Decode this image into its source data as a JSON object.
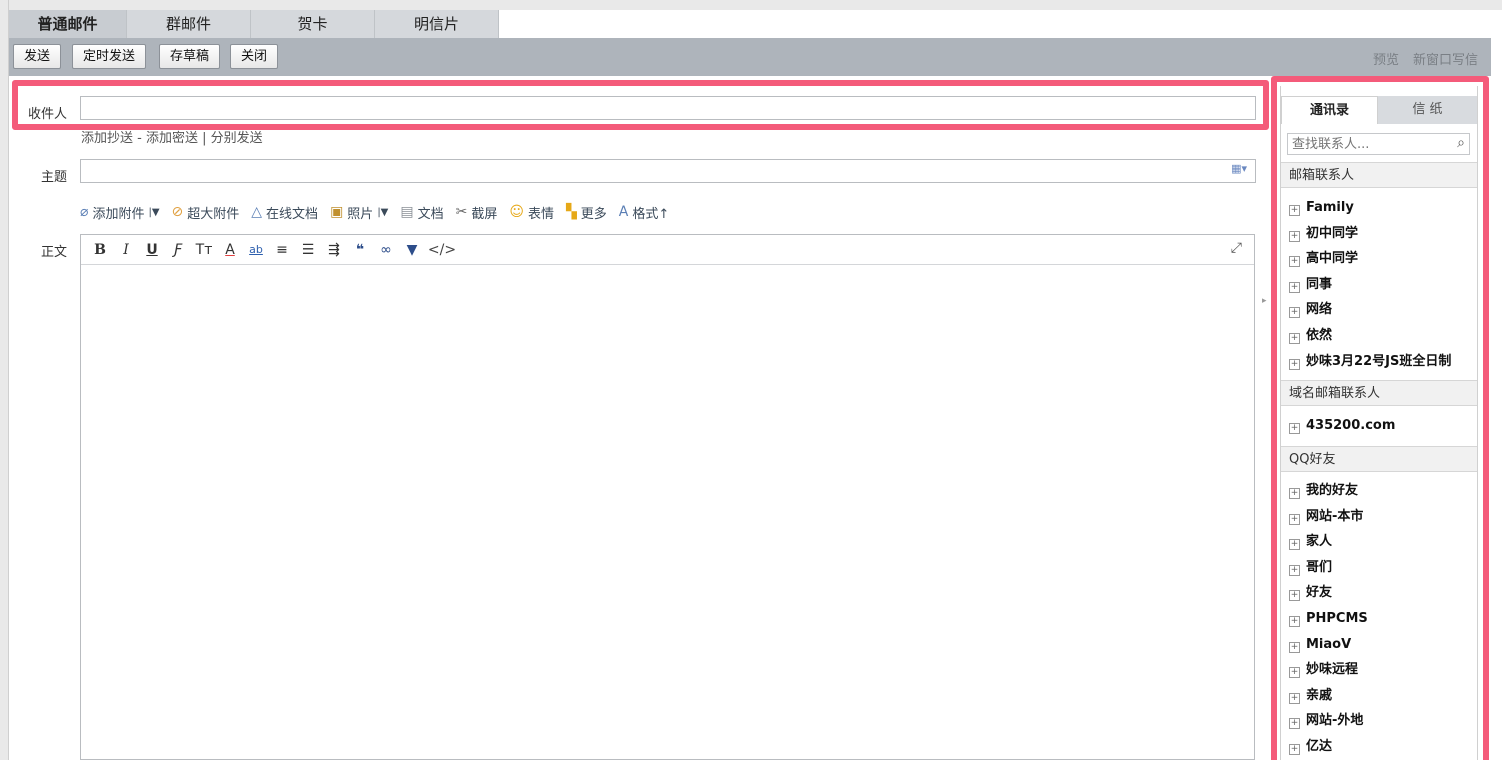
{
  "tabs": [
    "普通邮件",
    "群邮件",
    "贺卡",
    "明信片"
  ],
  "toolbar": {
    "send": "发送",
    "scheduled_send": "定时发送",
    "save_draft": "存草稿",
    "close": "关闭",
    "preview": "预览",
    "new_window": "新窗口写信"
  },
  "compose": {
    "to_label": "收件人",
    "to_value": "",
    "add_cc": "添加抄送",
    "sep1": " - ",
    "add_bcc": "添加密送",
    "sep2": " | ",
    "separate_send": "分别发送",
    "subject_label": "主题",
    "subject_value": "",
    "body_label": "正文"
  },
  "attachments": [
    {
      "icon": "paperclip-icon",
      "label": "添加附件",
      "dropdown": true
    },
    {
      "icon": "large-attachment-icon",
      "label": "超大附件",
      "dropdown": false
    },
    {
      "icon": "online-doc-icon",
      "label": "在线文档",
      "dropdown": false
    },
    {
      "icon": "photo-icon",
      "label": "照片",
      "dropdown": true
    },
    {
      "icon": "document-icon",
      "label": "文档",
      "dropdown": false
    },
    {
      "icon": "screenshot-icon",
      "label": "截屏",
      "dropdown": false
    },
    {
      "icon": "emoji-icon",
      "label": "表情",
      "dropdown": false
    },
    {
      "icon": "more-icon",
      "label": "更多",
      "dropdown": false
    },
    {
      "icon": "format-icon",
      "label": "格式↑",
      "dropdown": false
    }
  ],
  "editor_tools": [
    {
      "name": "bold",
      "glyph": "B"
    },
    {
      "name": "italic",
      "glyph": "I"
    },
    {
      "name": "underline",
      "glyph": "U"
    },
    {
      "name": "font",
      "glyph": "Ƒ"
    },
    {
      "name": "font-size",
      "glyph": "Tт"
    },
    {
      "name": "font-color",
      "glyph": "A"
    },
    {
      "name": "background-color",
      "glyph": "ab"
    },
    {
      "name": "align",
      "glyph": "≡"
    },
    {
      "name": "list",
      "glyph": "☰"
    },
    {
      "name": "indent",
      "glyph": "⇶"
    },
    {
      "name": "quote",
      "glyph": "❝"
    },
    {
      "name": "link",
      "glyph": "∞"
    },
    {
      "name": "highlight",
      "glyph": "▼"
    },
    {
      "name": "source",
      "glyph": "</>"
    }
  ],
  "sidebar": {
    "tab_contacts": "通讯录",
    "tab_stationery": "信 纸",
    "search_placeholder": "查找联系人...",
    "mail_contacts_title": "邮箱联系人",
    "mail_groups": [
      "Family",
      "初中同学",
      "高中同学",
      "同事",
      "网络",
      "依然",
      "妙味3月22号JS班全日制"
    ],
    "domain_contacts_title": "域名邮箱联系人",
    "domain_groups": [
      "435200.com"
    ],
    "qq_friends_title": "QQ好友",
    "qq_groups": [
      "我的好友",
      "网站-本市",
      "家人",
      "哥们",
      "好友",
      "PHPCMS",
      "MiaoV",
      "妙味远程",
      "亲戚",
      "网站-外地",
      "亿达"
    ]
  },
  "colors": {
    "highlight_outline": "#f45b7a",
    "toolbar_bg": "#aeb4bb",
    "tab_bg": "#d5d8dc"
  }
}
